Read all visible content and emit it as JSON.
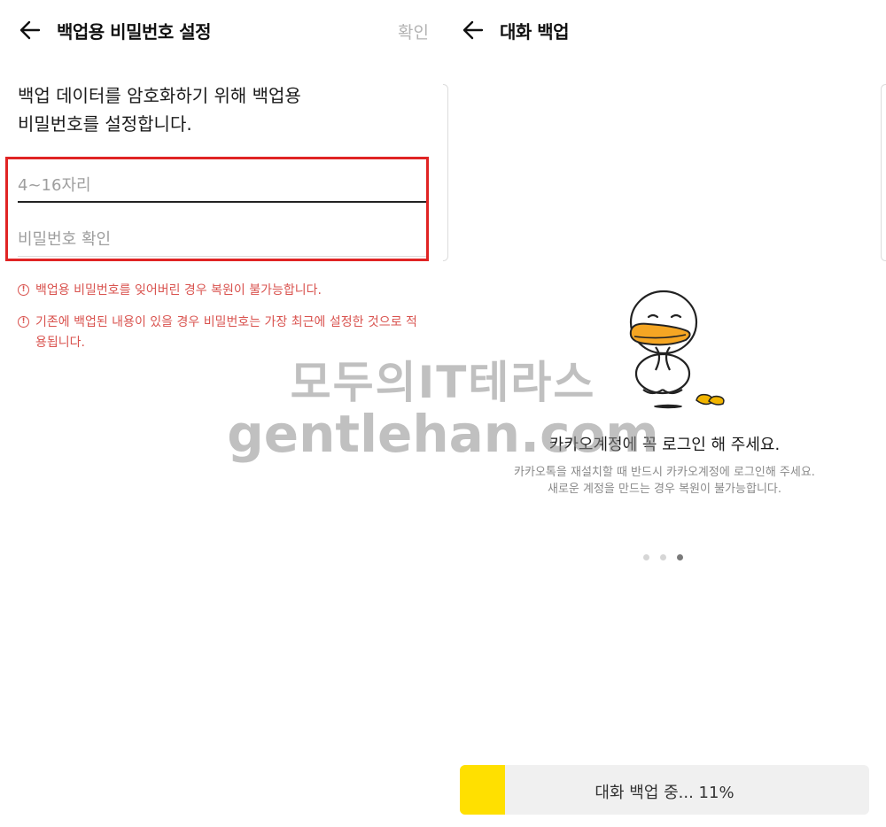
{
  "left_screen": {
    "title": "백업용 비밀번호 설정",
    "confirm_label": "확인",
    "intro_line1": "백업 데이터를 암호화하기 위해 백업용",
    "intro_line2": "비밀번호를 설정합니다.",
    "password_placeholder": "4~16자리",
    "password_confirm_placeholder": "비밀번호 확인",
    "warnings": [
      "백업용 비밀번호를 잊어버린 경우 복원이 불가능합니다.",
      "기존에 백업된 내용이 있을 경우 비밀번호는 가장 최근에 설정한 것으로 적용됩니다."
    ],
    "warning_icon": "exclamation-circle-icon",
    "warning_color": "#d9534f",
    "highlight_color": "#e02424"
  },
  "right_screen": {
    "title": "대화 백업",
    "message_title": "카카오계정에 꼭 로그인 해 주세요.",
    "message_sub1": "카카오톡을 재설치할 때 반드시 카카오계정에 로그인해 주세요.",
    "message_sub2": "새로운 계정을 만드는 경우 복원이 불가능합니다.",
    "page_indicator": {
      "count": 3,
      "active_index": 2
    },
    "progress": {
      "label": "대화 백업 중... 11%",
      "percent": 11,
      "fill_color": "#ffe000"
    }
  },
  "watermark": {
    "line1": "모두의IT테라스",
    "line2": "gentlehan.com"
  }
}
